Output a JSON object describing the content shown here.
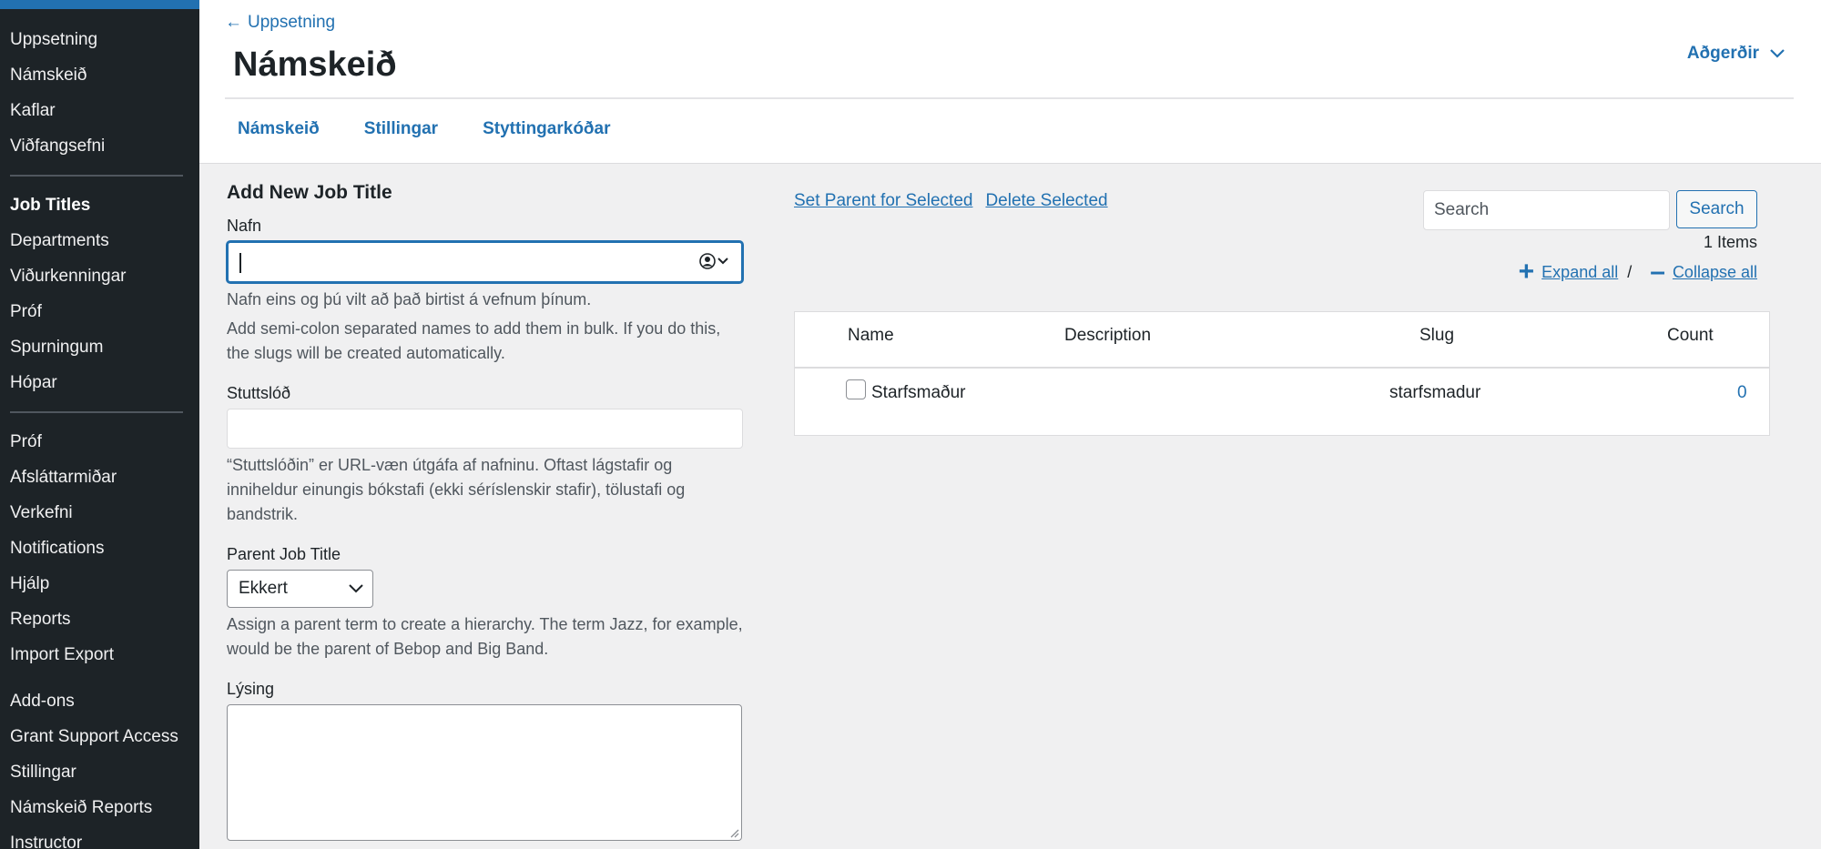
{
  "sidebar": {
    "group1": [
      "Uppsetning",
      "Námskeið",
      "Kaflar",
      "Viðfangsefni"
    ],
    "group2": [
      "Job Titles",
      "Departments",
      "Viðurkenningar",
      "Próf",
      "Spurningum",
      "Hópar"
    ],
    "group3": [
      "Próf",
      "Afsláttarmiðar",
      "Verkefni",
      "Notifications",
      "Hjálp",
      "Reports",
      "Import Export"
    ],
    "group4": [
      "Add-ons",
      "Grant Support Access",
      "Stillingar",
      "Námskeið Reports",
      "Instructor"
    ]
  },
  "header": {
    "back_label": "Uppsetning",
    "title": "Námskeið",
    "actions_label": "Aðgerðir",
    "tabs": [
      "Námskeið",
      "Stillingar",
      "Styttingarkóðar"
    ]
  },
  "form": {
    "heading": "Add New Job Title",
    "name_label": "Nafn",
    "name_value": "",
    "name_help1": "Nafn eins og þú vilt að það birtist á vefnum þínum.",
    "name_help2": "Add semi-colon separated names to add them in bulk. If you do this, the slugs will be created automatically.",
    "slug_label": "Stuttslóð",
    "slug_value": "",
    "slug_help": "“Stuttslóðin” er URL-væn útgáfa af nafninu. Oftast lágstafir og inniheldur einungis bókstafi (ekki séríslenskir stafir), tölustafi og bandstrik.",
    "parent_label": "Parent Job Title",
    "parent_value": "Ekkert",
    "parent_help": "Assign a parent term to create a hierarchy. The term Jazz, for example, would be the parent of Bebop and Big Band.",
    "desc_label": "Lýsing"
  },
  "list": {
    "set_parent": "Set Parent for Selected",
    "delete_selected": "Delete Selected",
    "search_placeholder": "Search",
    "search_button": "Search",
    "items_count": "1 Items",
    "expand_all": "Expand all",
    "separator": "/",
    "collapse_all": "Collapse all",
    "columns": {
      "name": "Name",
      "description": "Description",
      "slug": "Slug",
      "count": "Count"
    },
    "rows": [
      {
        "name": "Starfsmaður",
        "description": "",
        "slug": "starfsmadur",
        "count": "0"
      }
    ]
  },
  "colors": {
    "accent": "#2271b1",
    "sidebar": "#1d2327",
    "background": "#f0f0f1"
  }
}
